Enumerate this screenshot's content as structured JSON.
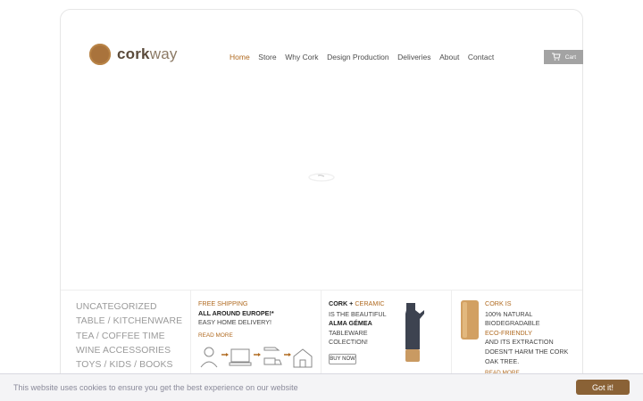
{
  "brand": {
    "logo_part1": "cork",
    "logo_part2": "way"
  },
  "nav": {
    "items": [
      {
        "label": "Home",
        "active": true
      },
      {
        "label": "Store"
      },
      {
        "label": "Why Cork"
      },
      {
        "label": "Design Production"
      },
      {
        "label": "Deliveries"
      },
      {
        "label": "About"
      },
      {
        "label": "Contact"
      }
    ]
  },
  "cart": {
    "label": "Cart",
    "icon": "cart-icon"
  },
  "categories": [
    "UNCATEGORIZED",
    "TABLE / KITCHENWARE",
    "TEA / COFFEE TIME",
    "WINE ACCESSORIES",
    "TOYS / KIDS / BOOKS"
  ],
  "promo_shipping": {
    "line1": "FREE SHIPPING",
    "line2": "ALL AROUND EUROPE!*",
    "line3": "EASY HOME DELIVERY!",
    "link": "READ MORE"
  },
  "promo_ceramic": {
    "title_part1": "CORK + ",
    "title_part2": "CERAMIC",
    "line1": "IS THE BEAUTIFUL",
    "line2": "ALMA GÉMEA",
    "line3": "TABLEWARE",
    "line4": "COLECTION!",
    "button": "BUY NOW"
  },
  "promo_cork": {
    "title": "CORK IS",
    "line1": "100% NATURAL",
    "line2": "BIODEGRADABLE",
    "line3": "ECO-FRIENDLY",
    "line4": "AND ITS EXTRACTION",
    "line5": "DOESN'T HARM THE CORK",
    "line6": "OAK TREE.",
    "link": "READ MORE"
  },
  "cookie": {
    "text": "This website uses cookies to ensure you get the best experience on our website",
    "button": "Got it!"
  },
  "colors": {
    "accent": "#b06a20",
    "cookie_button": "#8a6236",
    "cart_bg": "#a3a3a3"
  }
}
